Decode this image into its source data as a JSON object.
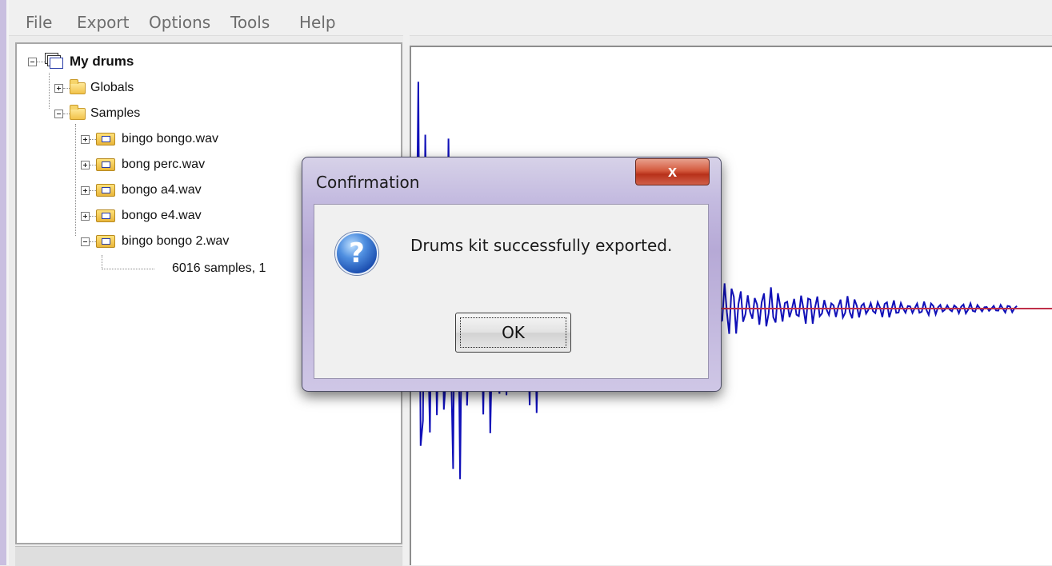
{
  "menu": [
    "File",
    "Export",
    "Options",
    "Tools",
    "Help"
  ],
  "tree": {
    "root": "My drums",
    "globals": "Globals",
    "samples": "Samples",
    "files": [
      "bingo bongo.wav",
      "bong perc.wav",
      "bongo a4.wav",
      "bongo e4.wav",
      "bingo bongo 2.wav"
    ],
    "detail": "6016 samples, 1"
  },
  "waveform": {
    "baseline_color": "#c0304a",
    "wave_color": "#1010b8"
  },
  "dialog": {
    "title": "Confirmation",
    "close_label": "x",
    "message": "Drums kit successfully exported.",
    "icon": "question-icon",
    "ok_label": "OK"
  }
}
